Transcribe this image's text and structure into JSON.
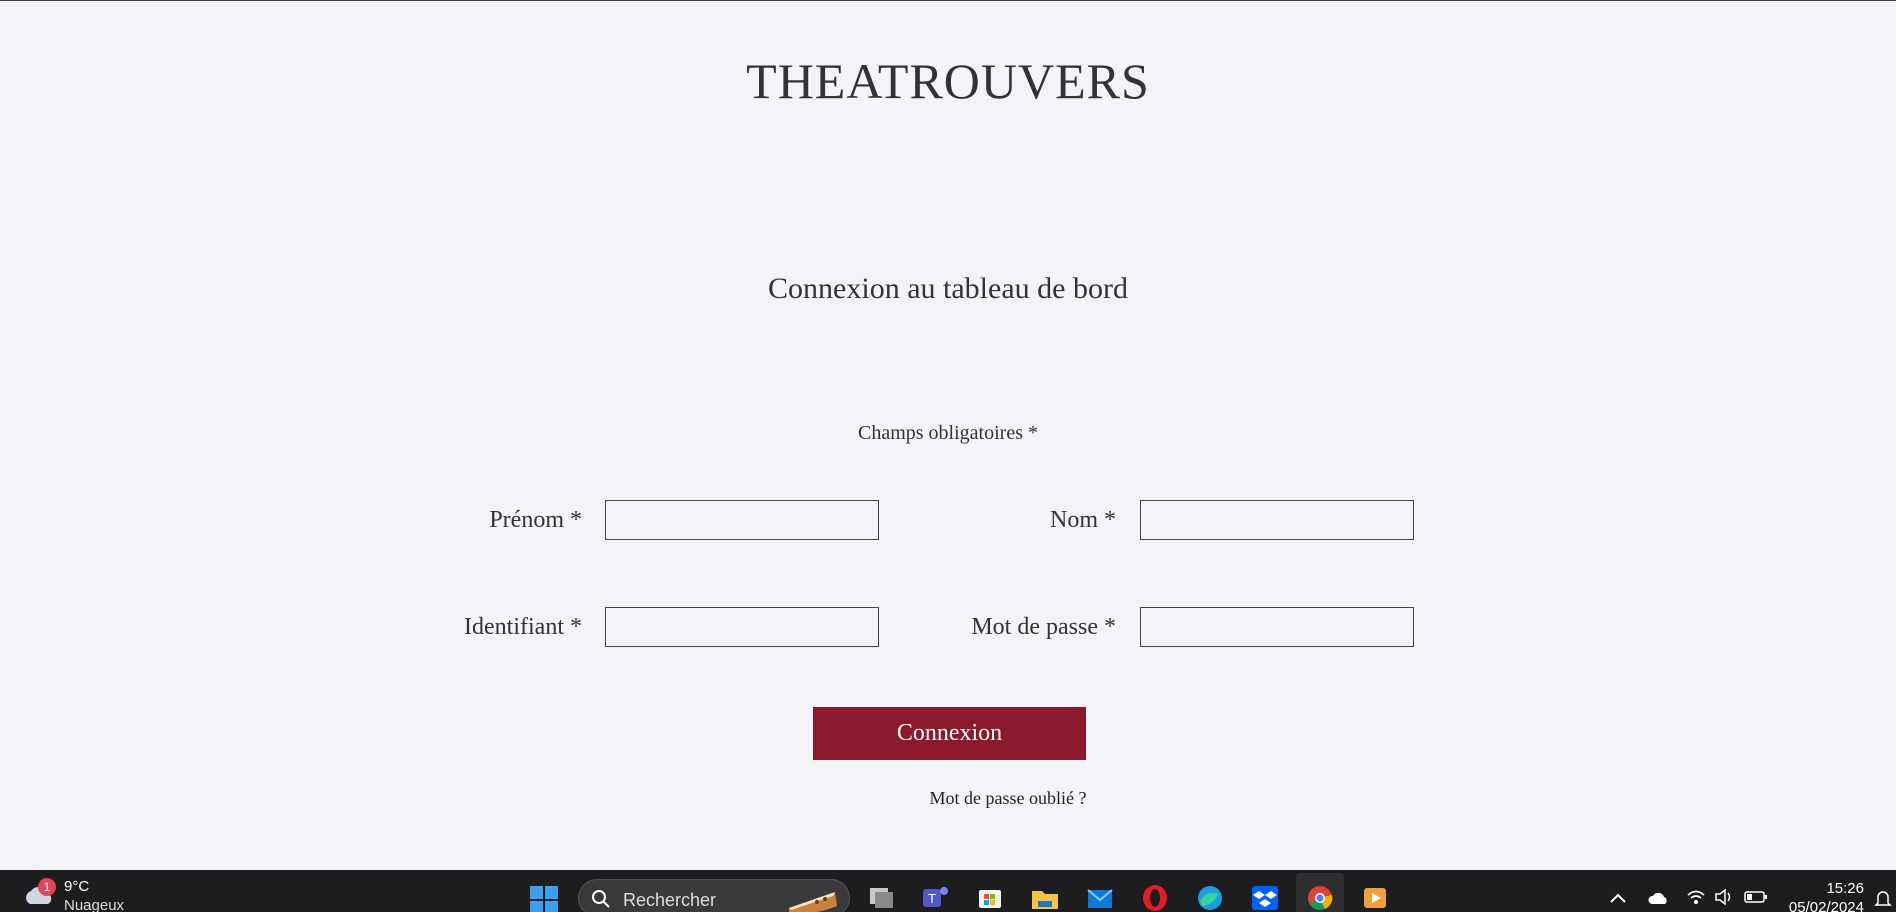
{
  "header": {
    "site_title": "THEATROUVERS"
  },
  "main": {
    "subtitle": "Connexion au tableau de bord",
    "required_note": "Champs obligatoires *",
    "fields": {
      "prenom": {
        "label": "Prénom *",
        "value": ""
      },
      "nom": {
        "label": "Nom *",
        "value": ""
      },
      "identifiant": {
        "label": "Identifiant *",
        "value": ""
      },
      "mot_de_passe": {
        "label": "Mot de passe *",
        "value": ""
      }
    },
    "submit_label": "Connexion",
    "forgot_link": "Mot de passe oublié ?"
  },
  "colors": {
    "background": "#f4f4f8",
    "accent": "#8c1a2c",
    "text": "#333333",
    "taskbar": "#1d1d1f"
  },
  "taskbar": {
    "weather": {
      "badge": "1",
      "temperature": "9°C",
      "description": "Nuageux",
      "icon": "cloud-icon"
    },
    "start_icon": "windows-start-icon",
    "search": {
      "placeholder": "Rechercher"
    },
    "apps": [
      "task-view-icon",
      "teams-icon",
      "microsoft-store-icon",
      "file-explorer-icon",
      "mail-icon",
      "opera-icon",
      "edge-icon",
      "dropbox-icon",
      "chrome-icon",
      "media-player-icon"
    ],
    "tray": [
      "chevron-up-icon",
      "onedrive-icon",
      "wifi-icon",
      "volume-icon",
      "battery-icon",
      "notifications-icon"
    ],
    "clock": {
      "time": "15:26",
      "date": "05/02/2024"
    }
  }
}
